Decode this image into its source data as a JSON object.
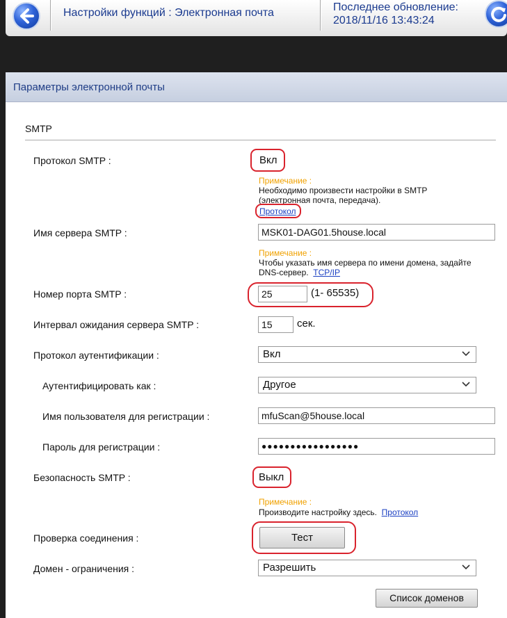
{
  "header": {
    "title": "Настройки функций : Электронная почта",
    "last_update_label": "Последнее обновление:",
    "last_update_value": "2018/11/16 13:43:24",
    "back_icon": "back-arrow-icon",
    "refresh_icon": "refresh-icon"
  },
  "panel": {
    "title": "Параметры электронной почты",
    "section": "SMTP"
  },
  "smtp_protocol": {
    "label": "Протокол SMTP :",
    "value": "Вкл",
    "note_title": "Примечание :",
    "note_line1": "Необходимо произвести настройки в SMTP",
    "note_line2": "(электронная почта, передача).",
    "link": "Протокол"
  },
  "smtp_server": {
    "label": "Имя сервера SMTP :",
    "value": "MSK01-DAG01.5house.local",
    "note_title": "Примечание :",
    "note_line1": "Чтобы указать имя сервера по имени домена, задайте",
    "note_line2": "DNS-сервер.",
    "link": "TCP/IP"
  },
  "smtp_port": {
    "label": "Номер порта SMTP :",
    "value": "25",
    "range": "(1- 65535)"
  },
  "timeout": {
    "label": "Интервал ожидания сервера SMTP :",
    "value": "15",
    "unit": "сек."
  },
  "auth_protocol": {
    "label": "Протокол аутентификации :",
    "value": "Вкл"
  },
  "auth_as": {
    "label": "Аутентифицировать как :",
    "value": "Другое"
  },
  "login_user": {
    "label": "Имя пользователя для регистрации :",
    "value": "mfuScan@5house.local"
  },
  "login_password": {
    "label": "Пароль для регистрации :",
    "value": "●●●●●●●●●●●●●●●●●"
  },
  "smtp_security": {
    "label": "Безопасность SMTP :",
    "value": "Выкл",
    "note_title": "Примечание :",
    "note_text": "Производите настройку здесь.",
    "link": "Протокол"
  },
  "connection_check": {
    "label": "Проверка соединения :",
    "button": "Тест"
  },
  "domain_restriction": {
    "label": "Домен - ограничения :",
    "value": "Разрешить",
    "button": "Список доменов"
  },
  "colors": {
    "highlight": "#d9232d",
    "note": "#f0a100",
    "link": "#1a3fc2",
    "header_text": "#1a3a8f"
  }
}
